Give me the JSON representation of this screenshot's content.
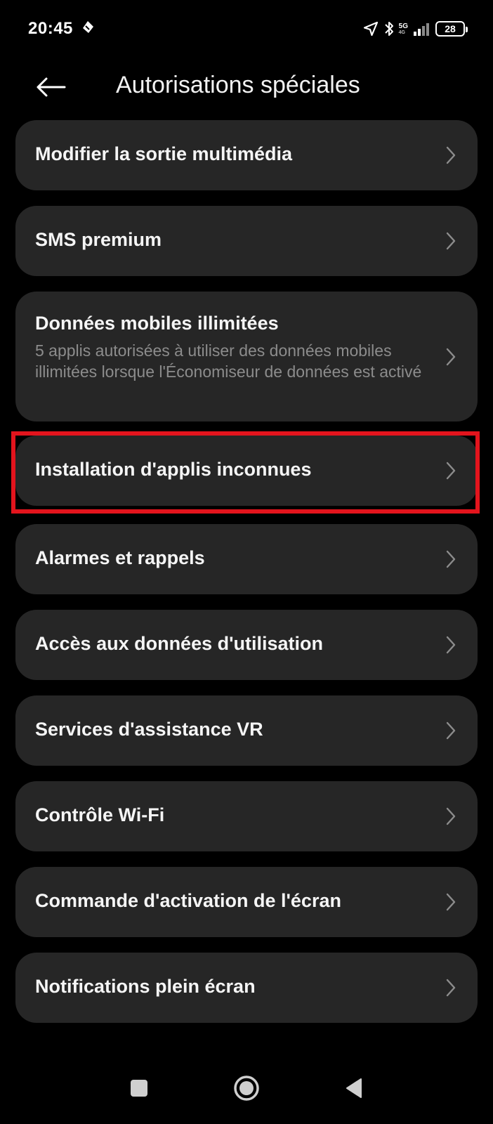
{
  "status_bar": {
    "time": "20:45",
    "network": "5G",
    "network_sub": "4G",
    "battery": "28",
    "icons": [
      "notification-app-icon",
      "location-icon",
      "bluetooth-icon",
      "signal-icon",
      "battery-icon"
    ]
  },
  "header": {
    "title": "Autorisations spéciales",
    "back_icon": "arrow-left-icon"
  },
  "items": [
    {
      "label": "Modifier la sortie multimédia"
    },
    {
      "label": "SMS premium"
    },
    {
      "label": "Données mobiles illimitées",
      "subtitle": "5 applis autorisées à utiliser des données mobiles illimitées lorsque l'Économiseur de données est activé"
    },
    {
      "label": "Installation d'applis inconnues",
      "highlighted": true
    },
    {
      "label": "Alarmes et rappels"
    },
    {
      "label": "Accès aux données d'utilisation"
    },
    {
      "label": "Services d'assistance VR"
    },
    {
      "label": "Contrôle Wi-Fi"
    },
    {
      "label": "Commande d'activation de l'écran"
    },
    {
      "label": "Notifications plein écran"
    }
  ],
  "nav_bar": {
    "buttons": [
      "recents-square-icon",
      "home-circle-icon",
      "back-triangle-icon"
    ]
  },
  "colors": {
    "background": "#000000",
    "card": "#262626",
    "highlight": "#e3141d",
    "subtitle": "#8c8c8c"
  }
}
